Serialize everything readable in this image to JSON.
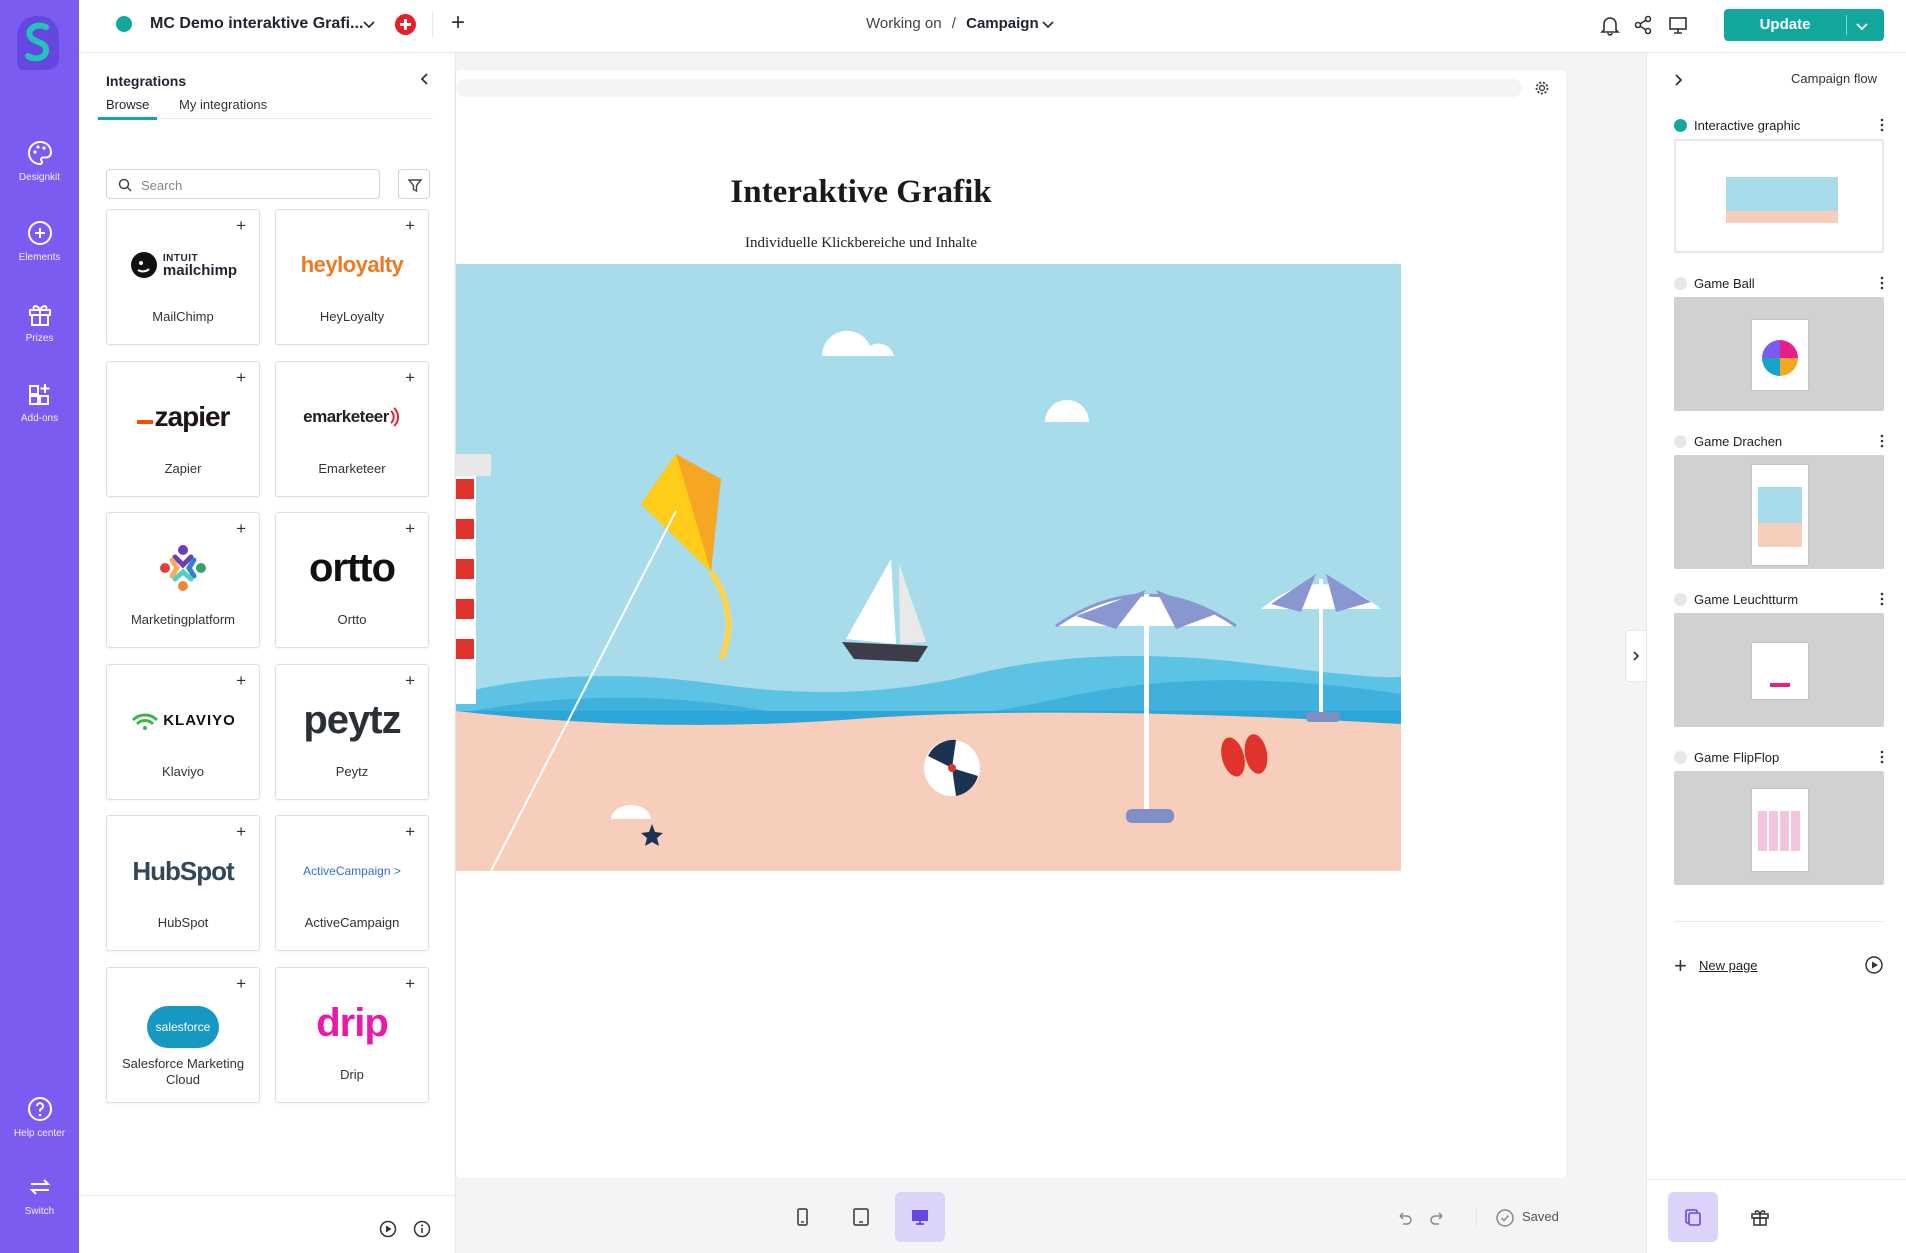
{
  "nav": {
    "items": [
      {
        "label": "Designkit",
        "icon": "palette-icon"
      },
      {
        "label": "Elements",
        "icon": "plus-circle-icon"
      },
      {
        "label": "Prizes",
        "icon": "gift-icon"
      },
      {
        "label": "Add-ons",
        "icon": "add-ons-icon"
      }
    ],
    "help_label": "Help center",
    "switch_label": "Switch"
  },
  "topbar": {
    "project_title": "MC Demo interaktive Grafi...",
    "working_on_label": "Working on",
    "breadcrumb_separator": "/",
    "mode": "Campaign",
    "update_label": "Update",
    "accent_color": "#13a89e"
  },
  "integrations": {
    "title": "Integrations",
    "tabs": [
      "Browse",
      "My integrations"
    ],
    "active_tab": "Browse",
    "search_placeholder": "Search",
    "cards": [
      {
        "name": "MailChimp",
        "logo_top": "INTUIT",
        "logo_bottom": "mailchimp"
      },
      {
        "name": "HeyLoyalty",
        "logo_text": "heyloyalty"
      },
      {
        "name": "Zapier",
        "logo_text": "zapier"
      },
      {
        "name": "Emarketeer",
        "logo_text": "emarketeer"
      },
      {
        "name": "Marketingplatform"
      },
      {
        "name": "Ortto",
        "logo_text": "ortto"
      },
      {
        "name": "Klaviyo",
        "logo_text": "KLAVIYO"
      },
      {
        "name": "Peytz",
        "logo_text": "peytz"
      },
      {
        "name": "HubSpot",
        "logo_text": "HubSpot"
      },
      {
        "name": "ActiveCampaign",
        "logo_text": "ActiveCampaign >"
      },
      {
        "name": "Salesforce Marketing Cloud",
        "logo_text": "salesforce"
      },
      {
        "name": "Drip",
        "logo_text": "drip"
      }
    ]
  },
  "canvas": {
    "title": "Interaktive Grafik",
    "subtitle": "Individuelle Klickbereiche und Inhalte"
  },
  "bottombar": {
    "saved_label": "Saved",
    "active_device": "desktop"
  },
  "campaign_flow": {
    "title": "Campaign flow",
    "pages": [
      {
        "name": "Interactive graphic",
        "active": true
      },
      {
        "name": "Game Ball",
        "active": false
      },
      {
        "name": "Game Drachen",
        "active": false
      },
      {
        "name": "Game Leuchtturm",
        "active": false
      },
      {
        "name": "Game FlipFlop",
        "active": false
      }
    ],
    "new_page_label": "New page"
  }
}
